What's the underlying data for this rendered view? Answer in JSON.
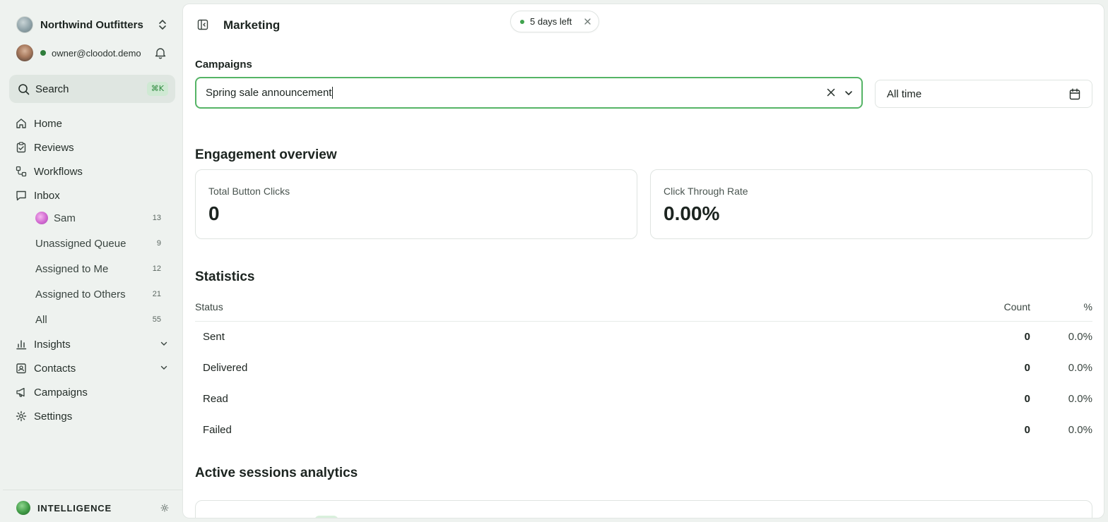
{
  "sidebar": {
    "org_name": "Northwind Outfitters",
    "user_email": "owner@cloodot.demo",
    "user_status_color": "#2e7d3a",
    "search": {
      "label": "Search",
      "shortcut": "⌘K"
    },
    "nav": [
      {
        "label": "Home",
        "icon": "home-icon"
      },
      {
        "label": "Reviews",
        "icon": "clipboard-check-icon"
      },
      {
        "label": "Workflows",
        "icon": "workflow-icon"
      },
      {
        "label": "Inbox",
        "icon": "message-icon"
      }
    ],
    "inbox_items": [
      {
        "label": "Sam",
        "count": "13"
      },
      {
        "label": "Unassigned Queue",
        "count": "9"
      },
      {
        "label": "Assigned to Me",
        "count": "12"
      },
      {
        "label": "Assigned to Others",
        "count": "21"
      },
      {
        "label": "All",
        "count": "55"
      }
    ],
    "nav_bottom": [
      {
        "label": "Insights",
        "icon": "chart-icon"
      },
      {
        "label": "Contacts",
        "icon": "contact-icon"
      },
      {
        "label": "Campaigns",
        "icon": "megaphone-icon"
      },
      {
        "label": "Settings",
        "icon": "gear-icon"
      }
    ],
    "intelligence_label": "INTELLIGENCE"
  },
  "header": {
    "title": "Marketing",
    "trial_badge": "5 days left"
  },
  "filters": {
    "campaign_label": "Campaigns",
    "campaign_value": "Spring sale announcement",
    "date_range": "All time"
  },
  "engagement": {
    "title": "Engagement overview",
    "cards": [
      {
        "label": "Total Button Clicks",
        "value": "0"
      },
      {
        "label": "Click Through Rate",
        "value": "0.00%"
      }
    ]
  },
  "statistics": {
    "title": "Statistics",
    "columns": [
      "Status",
      "Count",
      "%"
    ],
    "rows": [
      {
        "status": "Sent",
        "count": "0",
        "pct": "0.0%"
      },
      {
        "status": "Delivered",
        "count": "0",
        "pct": "0.0%"
      },
      {
        "status": "Read",
        "count": "0",
        "pct": "0.0%"
      },
      {
        "status": "Failed",
        "count": "0",
        "pct": "0.0%"
      }
    ]
  },
  "sessions": {
    "title": "Active sessions analytics"
  },
  "colors": {
    "accent": "#55b466",
    "sidebar_bg": "#eef2ef",
    "main_bg": "#ffffff"
  }
}
